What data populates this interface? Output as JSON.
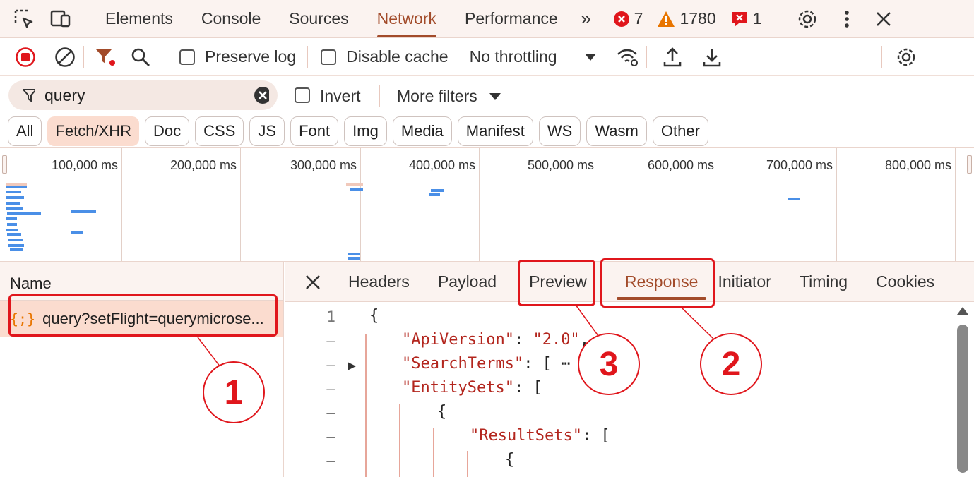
{
  "tabbar": {
    "tabs": [
      "Elements",
      "Console",
      "Sources",
      "Network",
      "Performance"
    ],
    "active_tab": "Network",
    "error_count": "7",
    "warning_count": "1780",
    "issue_count": "1"
  },
  "toolbar": {
    "preserve_log": "Preserve log",
    "disable_cache": "Disable cache",
    "throttling": "No throttling"
  },
  "filter": {
    "search_value": "query",
    "invert": "Invert",
    "more_filters": "More filters"
  },
  "chips": [
    "All",
    "Fetch/XHR",
    "Doc",
    "CSS",
    "JS",
    "Font",
    "Img",
    "Media",
    "Manifest",
    "WS",
    "Wasm",
    "Other"
  ],
  "active_chip": "Fetch/XHR",
  "timeline": {
    "ticks": [
      "100,000 ms",
      "200,000 ms",
      "300,000 ms",
      "400,000 ms",
      "500,000 ms",
      "600,000 ms",
      "700,000 ms",
      "800,000 ms"
    ]
  },
  "requests": {
    "header": "Name",
    "items": [
      "query?setFlight=querymicrose..."
    ]
  },
  "detail": {
    "tabs": [
      "Headers",
      "Payload",
      "Preview",
      "Response",
      "Initiator",
      "Timing",
      "Cookies"
    ],
    "active_tab": "Response"
  },
  "response": {
    "line_numbers": [
      "1",
      "–",
      "–",
      "–",
      "–",
      "–",
      "–"
    ],
    "lines": [
      {
        "text": "{"
      },
      {
        "key": "\"ApiVersion\"",
        "rest": ": ",
        "val": "\"2.0\"",
        "tail": ","
      },
      {
        "key": "\"SearchTerms\"",
        "rest": ": [ ⋯ ],",
        "val": "",
        "tail": ""
      },
      {
        "key": "\"EntitySets\"",
        "rest": ": [",
        "val": "",
        "tail": ""
      },
      {
        "text": "{"
      },
      {
        "key": "\"ResultSets\"",
        "rest": ": [",
        "val": "",
        "tail": ""
      },
      {
        "text": "{"
      }
    ]
  },
  "annotations": [
    "1",
    "2",
    "3"
  ],
  "colors": {
    "accent": "#a24b2a",
    "annotation_red": "#e0161c",
    "selected_bg": "#fbdccf",
    "timeline_bar": "#4a8fe7"
  }
}
